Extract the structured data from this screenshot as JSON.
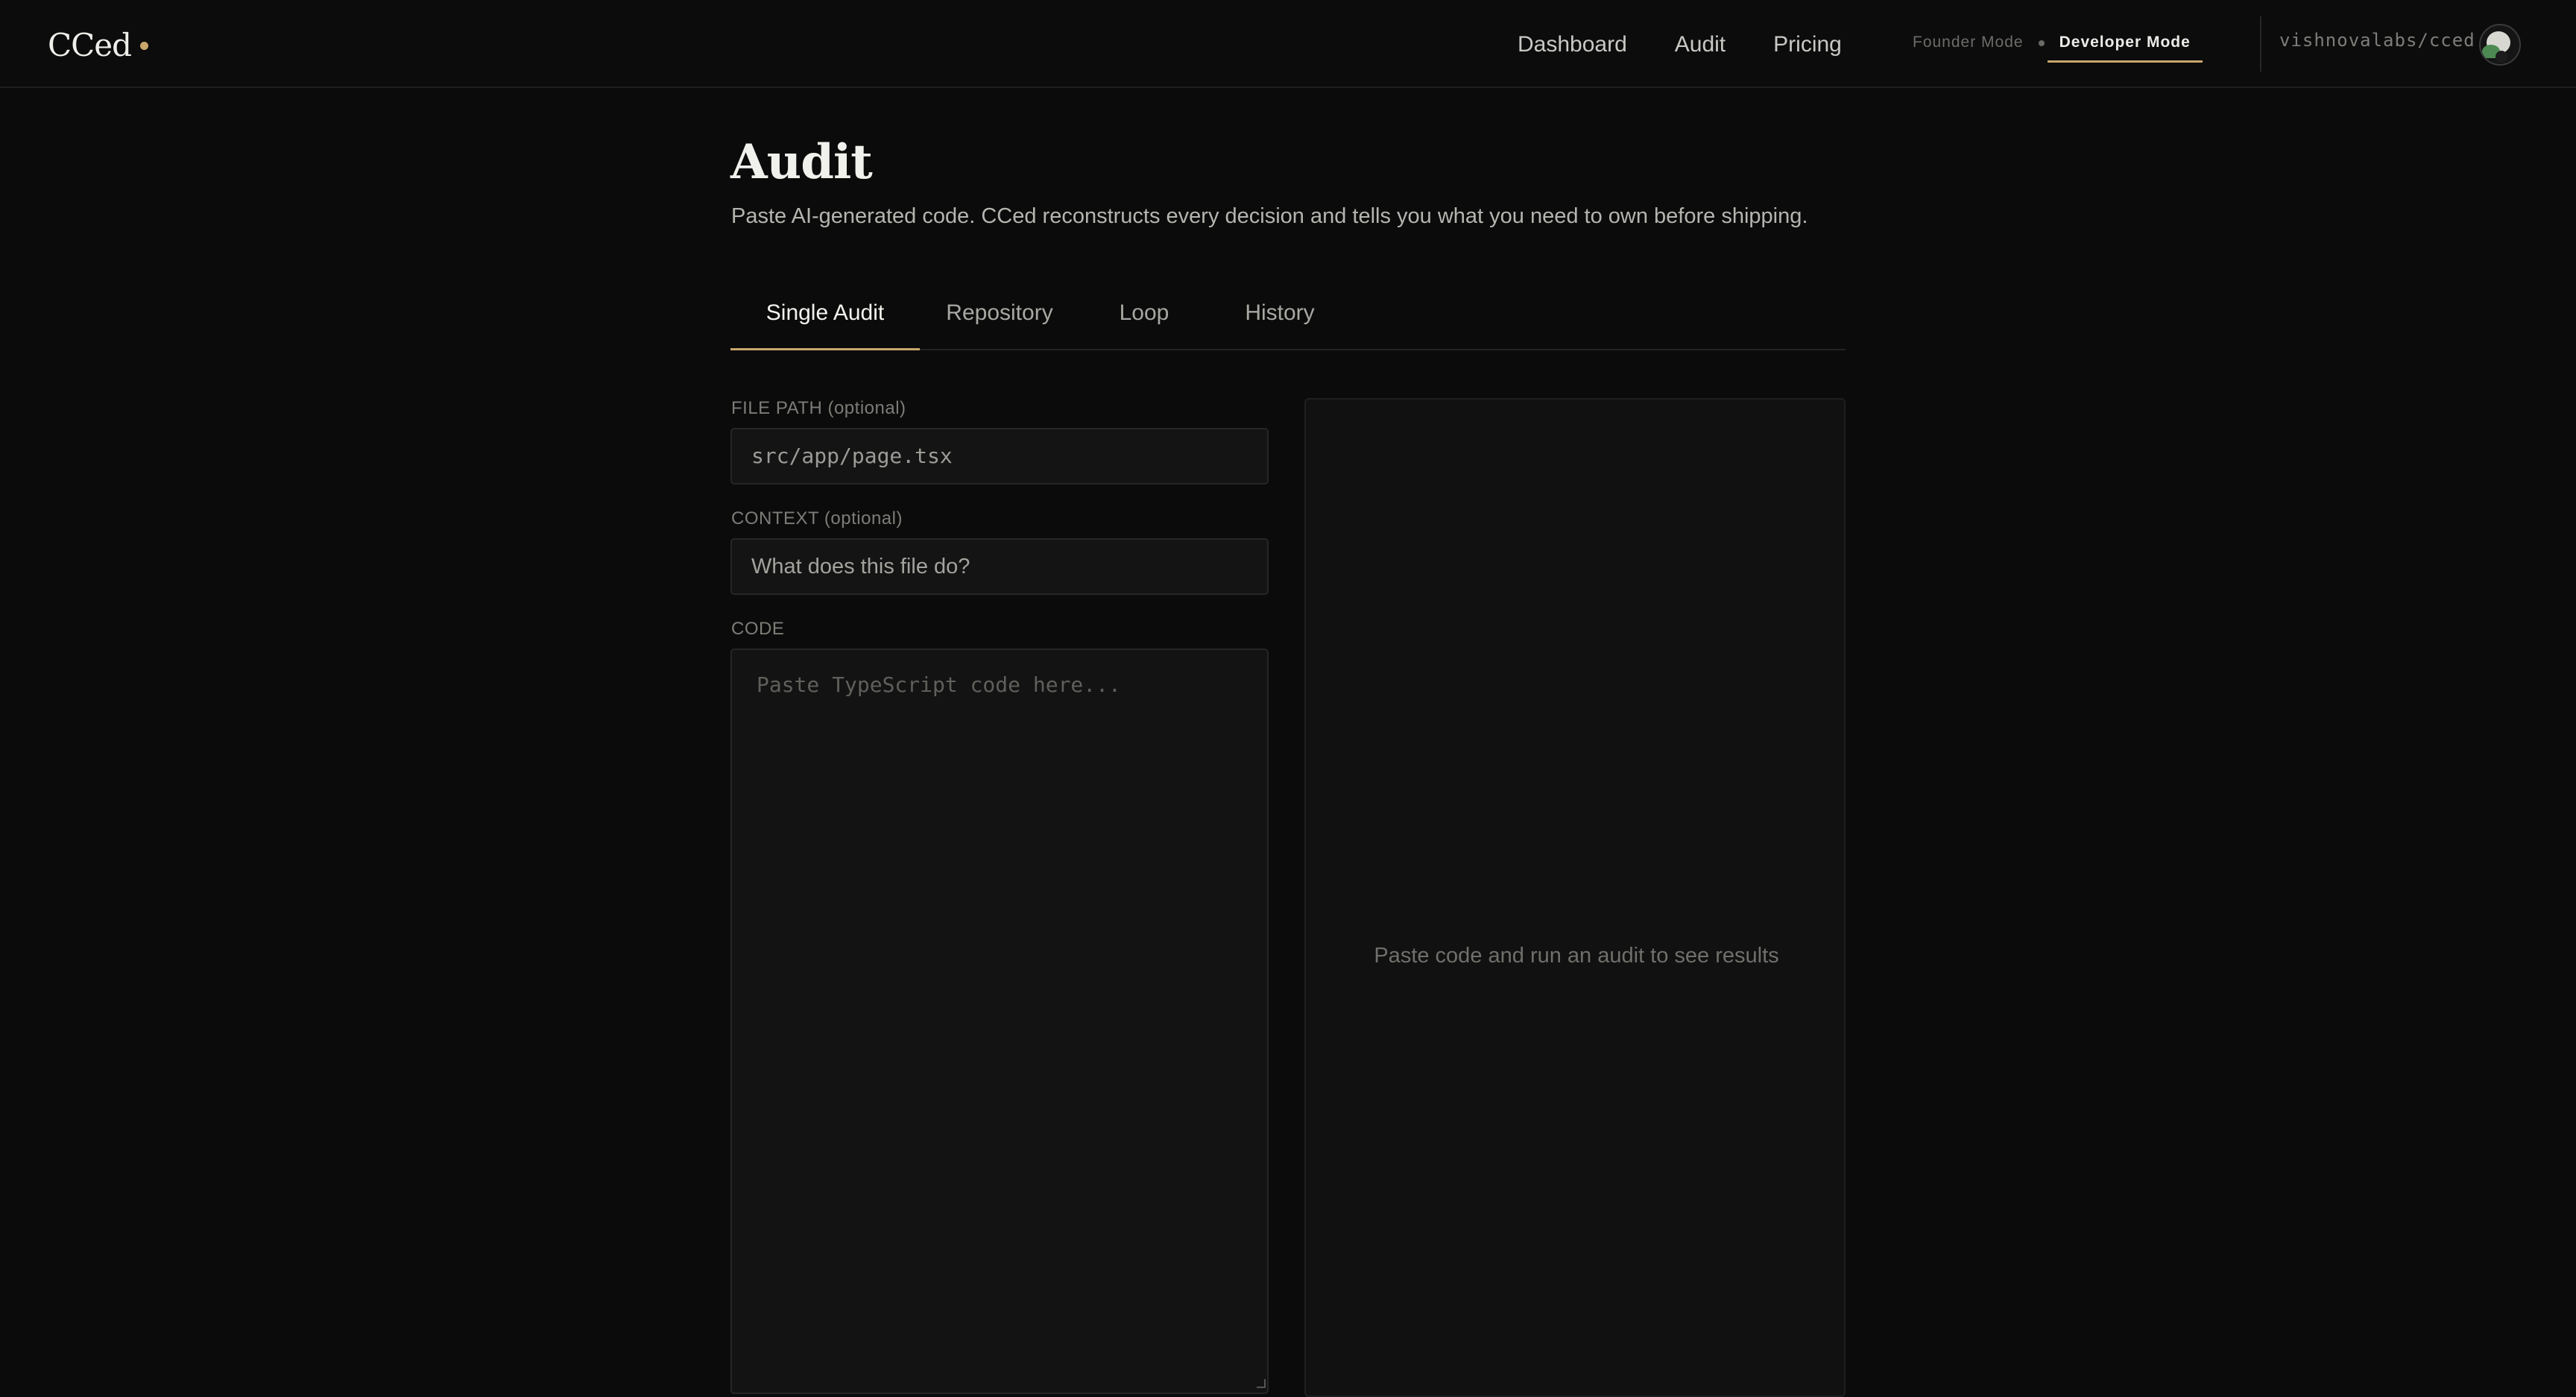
{
  "brand": {
    "name": "CCed"
  },
  "nav": {
    "links": [
      "Dashboard",
      "Audit",
      "Pricing"
    ],
    "modes": {
      "founder": "Founder Mode",
      "developer": "Developer Mode",
      "active": "developer"
    },
    "repo": "vishnovalabs/cced"
  },
  "page": {
    "title": "Audit",
    "subtitle": "Paste AI-generated code. CCed reconstructs every decision and tells you what you need to own before shipping."
  },
  "tabs": {
    "items": [
      "Single Audit",
      "Repository",
      "Loop",
      "History"
    ],
    "active": "Single Audit"
  },
  "form": {
    "file_path": {
      "label": "FILE PATH (optional)",
      "placeholder": "src/app/page.tsx"
    },
    "context": {
      "label": "CONTEXT (optional)",
      "placeholder": "What does this file do?"
    },
    "code": {
      "label": "CODE",
      "placeholder": "Paste TypeScript code here..."
    }
  },
  "results": {
    "empty_message": "Paste code and run an audit to see results"
  },
  "colors": {
    "accent": "#c9a66b",
    "background": "#0b0b0b",
    "panel": "#111111"
  }
}
